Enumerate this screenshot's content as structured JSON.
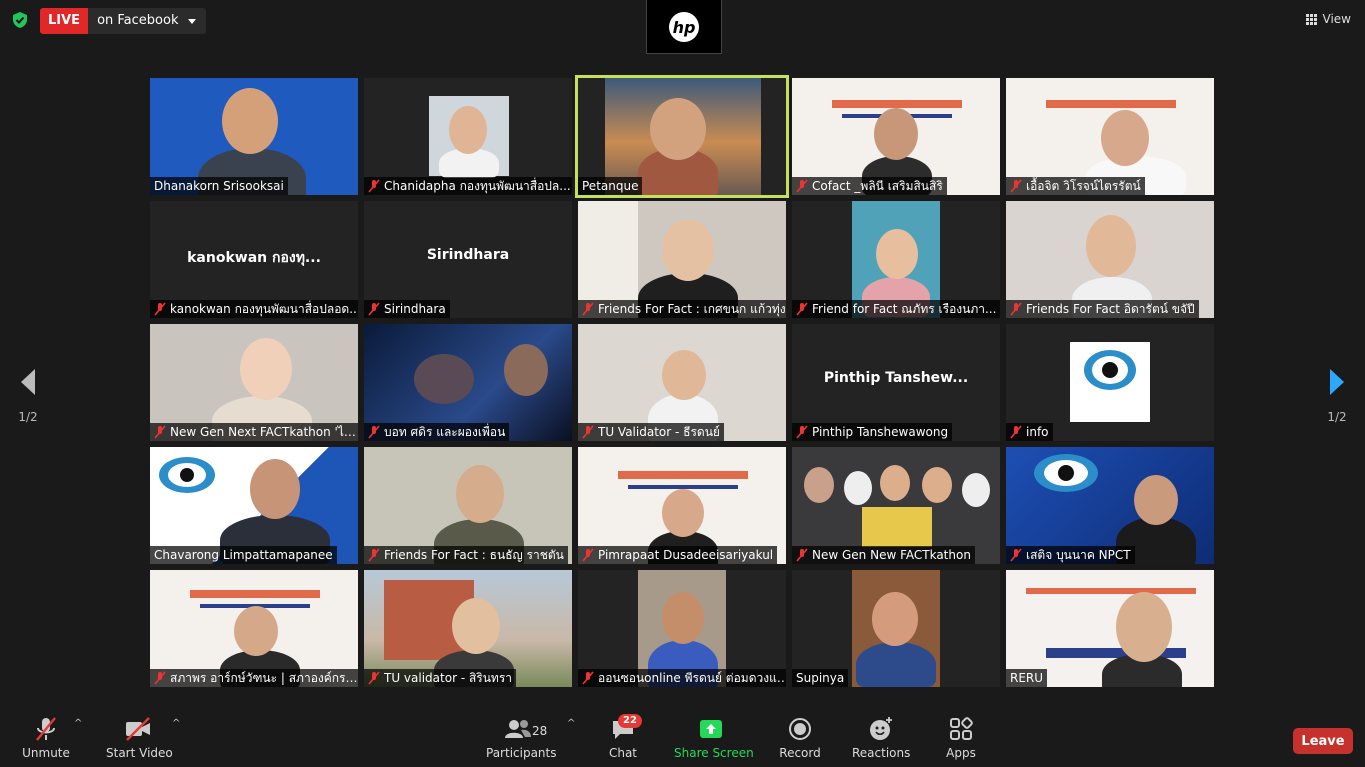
{
  "live": {
    "badge": "LIVE",
    "destination": "on Facebook"
  },
  "view_label": "View",
  "hp_logo": "hp",
  "pager": {
    "left": "1/2",
    "right": "1/2"
  },
  "tiles": [
    {
      "name": "Dhanakorn Srisooksai",
      "muted": false
    },
    {
      "name": "Chanidapha กองทุนพัฒนาสื่อปล...",
      "muted": true
    },
    {
      "name": "Petanque",
      "muted": false
    },
    {
      "name": "Cofact _พลินี  เสริมสินสิริ",
      "muted": true
    },
    {
      "name": "เอื้อจิต วิโรจน์ไตรรัตน์",
      "muted": true
    },
    {
      "name": "kanokwan กองทุนพัฒนาสื่อปลอด...",
      "muted": true,
      "big": "kanokwan กองทุ..."
    },
    {
      "name": "Sirindhara",
      "muted": true,
      "big": "Sirindhara"
    },
    {
      "name": "Friends For Fact : เกศขนก แก้วทุ่ง",
      "muted": true
    },
    {
      "name": "Friend for Fact ณภัทร เรืองนภา...",
      "muted": true
    },
    {
      "name": "Friends For Fact อิดารัตน์ ขจัปี",
      "muted": true
    },
    {
      "name": "New Gen Next FACTkathon 'ไอ...",
      "muted": true
    },
    {
      "name": "บอท ศดิร และผองเพื่อน",
      "muted": true
    },
    {
      "name": "TU Validator - ธีรดนย์",
      "muted": true
    },
    {
      "name": "Pinthip Tanshewawong",
      "muted": true,
      "big": "Pinthip  Tanshew..."
    },
    {
      "name": "info",
      "muted": true
    },
    {
      "name": "Chavarong Limpattamapanee",
      "muted": false
    },
    {
      "name": "Friends For Fact : ธนธัญ ราชตัน",
      "muted": true
    },
    {
      "name": "Pimrapaat Dusadeeisariyakul",
      "muted": true
    },
    {
      "name": "New Gen New FACTkathon",
      "muted": true
    },
    {
      "name": "เสติจ บุนนาค NPCT",
      "muted": true
    },
    {
      "name": "สภาพร อาร์กษ์วัฑนะ | สภาองค์กรช...",
      "muted": true
    },
    {
      "name": "TU validator - สิรินทรา",
      "muted": true
    },
    {
      "name": "ออนซอนonline พีรดนย์ ต่อมดวงแก้ว",
      "muted": true
    },
    {
      "name": "Supinya",
      "muted": false
    },
    {
      "name": "RERU",
      "muted": false
    }
  ],
  "toolbar": {
    "unmute": "Unmute",
    "start_video": "Start Video",
    "participants": "Participants",
    "participants_count": "28",
    "chat": "Chat",
    "chat_badge": "22",
    "share_screen": "Share Screen",
    "record": "Record",
    "reactions": "Reactions",
    "apps": "Apps",
    "leave": "Leave"
  },
  "colors": {
    "live_red": "#e02828",
    "active_border": "#c5e05a",
    "share_green": "#23d959",
    "leave_red": "#c7312c"
  }
}
